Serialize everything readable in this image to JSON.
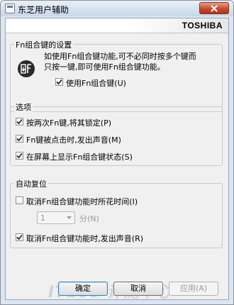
{
  "window": {
    "title": "东芝用户辅助"
  },
  "brand": {
    "logo_text": "TOSHIBA"
  },
  "fn_group": {
    "title": "Fn组合键的设置",
    "icon": "fn-key-icon",
    "description_line1": "如使用Fn组合键功能,可不必同时按多个键而",
    "description_line2": "只按一键,即可使用Fn组合键功能。",
    "use_fn_label": "使用Fn组合键(U)",
    "use_fn_checked": true
  },
  "options_group": {
    "title": "选项",
    "items": [
      {
        "label": "按两次Fn键,将其锁定(P)",
        "checked": true
      },
      {
        "label": "Fn键被点击时,发出声音(M)",
        "checked": true
      },
      {
        "label": "在屏幕上显示Fn组合键状态(S)",
        "checked": true
      }
    ]
  },
  "reset_group": {
    "title": "自动复位",
    "cancel_time_label": "取消Fn组合键功能时所花时间(I)",
    "cancel_time_checked": false,
    "minutes_value": "1",
    "minutes_unit": "分(N)",
    "cancel_sound_label": "取消Fn组合键功能时,发出声音(R)",
    "cancel_sound_checked": true
  },
  "buttons": {
    "ok": "确定",
    "cancel": "取消",
    "apply": "应用(A)"
  },
  "watermark_text": "IT168 评测中心",
  "colors": {
    "accent": "#3c7fb1",
    "close": "#c64b2f"
  }
}
